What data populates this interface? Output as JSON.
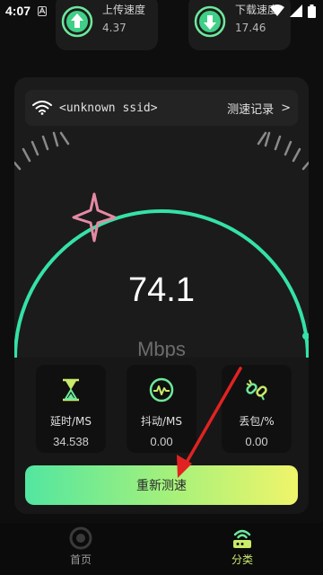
{
  "status_bar": {
    "time": "4:07"
  },
  "upload": {
    "label": "上传速度",
    "value": "4.37",
    "icon": "upload-arrow-icon",
    "color": "#6ee89a"
  },
  "download": {
    "label": "下载速度",
    "value": "17.46",
    "icon": "download-arrow-icon",
    "color": "#6ee89a"
  },
  "network": {
    "ssid": "<unknown ssid>",
    "history_label": "测速记录",
    "history_chevron": ">"
  },
  "gauge": {
    "value": "74.1",
    "unit": "Mbps",
    "arc_color": "#35e2a6",
    "star_color": "#e58aa4"
  },
  "metrics": [
    {
      "name": "latency",
      "label": "延时/MS",
      "value": "34.538",
      "icon": "hourglass-icon"
    },
    {
      "name": "jitter",
      "label": "抖动/MS",
      "value": "0.00",
      "icon": "pulse-gauge-icon"
    },
    {
      "name": "packet_loss",
      "label": "丢包/%",
      "value": "0.00",
      "icon": "broken-link-icon"
    }
  ],
  "actions": {
    "retest_label": "重新测速"
  },
  "nav": {
    "home_label": "首页",
    "category_label": "分类",
    "active": "category",
    "active_color": "#cbe872"
  },
  "annotation": {
    "arrow_color": "#e22222"
  }
}
